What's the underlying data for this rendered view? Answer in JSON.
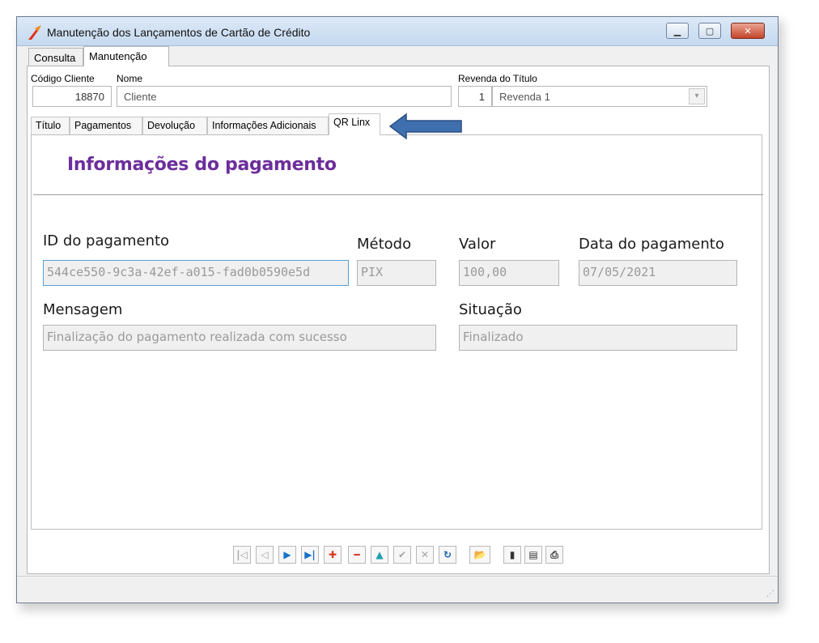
{
  "window": {
    "title": "Manutenção dos Lançamentos de Cartão de Crédito",
    "min_icon": "minimize-icon",
    "max_icon": "maximize-icon",
    "close_icon": "close-icon"
  },
  "main_tabs": [
    {
      "label": "Consulta",
      "active": false
    },
    {
      "label": "Manutenção",
      "active": true
    }
  ],
  "header": {
    "codigo_label": "Código Cliente",
    "codigo_value": "18870",
    "nome_label": "Nome",
    "nome_value": "Cliente",
    "revenda_label": "Revenda do Título",
    "revenda_num": "1",
    "revenda_value": "Revenda 1"
  },
  "sub_tabs": [
    {
      "label": "Título",
      "active": false
    },
    {
      "label": "Pagamentos",
      "active": false
    },
    {
      "label": "Devolução",
      "active": false
    },
    {
      "label": "Informações Adicionais",
      "active": false
    },
    {
      "label": "QR Linx",
      "active": true
    }
  ],
  "qr_linx": {
    "section_title": "Informações do pagamento",
    "id_label": "ID do pagamento",
    "id_value": "544ce550-9c3a-42ef-a015-fad0b0590e5d",
    "metodo_label": "Método",
    "metodo_value": "PIX",
    "valor_label": "Valor",
    "valor_value": "100,00",
    "data_label": "Data do pagamento",
    "data_value": "07/05/2021",
    "mensagem_label": "Mensagem",
    "mensagem_value": "Finalização do pagamento realizada com sucesso",
    "situacao_label": "Situação",
    "situacao_value": "Finalizado"
  },
  "toolbar": {
    "buttons": [
      {
        "name": "first-record-button",
        "glyph": "|◁",
        "icon": "first-icon"
      },
      {
        "name": "prev-record-button",
        "glyph": "◁",
        "icon": "prev-icon"
      },
      {
        "name": "next-record-button",
        "glyph": "▶",
        "icon": "next-icon"
      },
      {
        "name": "last-record-button",
        "glyph": "▶|",
        "icon": "last-icon"
      },
      {
        "name": "add-record-button",
        "glyph": "✚",
        "icon": "plus-icon"
      },
      {
        "name": "delete-record-button",
        "glyph": "━",
        "icon": "minus-icon"
      },
      {
        "name": "edit-record-button",
        "glyph": "▲",
        "icon": "up-icon"
      },
      {
        "name": "confirm-button",
        "glyph": "✔",
        "icon": "check-icon"
      },
      {
        "name": "cancel-button",
        "glyph": "✕",
        "icon": "cancel-icon"
      },
      {
        "name": "refresh-button",
        "glyph": "↻",
        "icon": "refresh-icon"
      },
      {
        "name": "open-button",
        "glyph": "📂",
        "icon": "folder-icon"
      },
      {
        "name": "exit-button",
        "glyph": "▮",
        "icon": "door-icon"
      },
      {
        "name": "report-button",
        "glyph": "▤",
        "icon": "report-icon"
      },
      {
        "name": "print-button",
        "glyph": "⎙",
        "icon": "print-icon"
      }
    ]
  },
  "colors": {
    "section_title": "#6c2e9b",
    "annotation_arrow": "#3f6fae"
  }
}
